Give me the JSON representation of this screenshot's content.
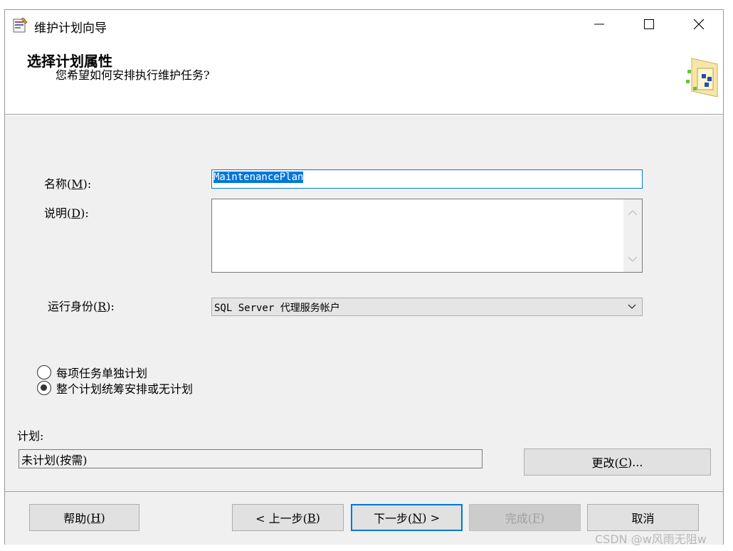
{
  "window": {
    "title": "维护计划向导"
  },
  "header": {
    "title": "选择计划属性",
    "subtitle": "您希望如何安排执行维护任务?"
  },
  "form": {
    "name_label_prefix": "名称(",
    "name_label_key": "M",
    "name_label_suffix": "):",
    "name_value": "MaintenancePlan",
    "desc_label_prefix": "说明(",
    "desc_label_key": "D",
    "desc_label_suffix": "):",
    "desc_value": "",
    "runas_label_prefix": "运行身份(",
    "runas_label_key": "R",
    "runas_label_suffix": "):",
    "runas_value": "SQL Server 代理服务帐户"
  },
  "schedule_options": {
    "option1": "每项任务单独计划",
    "option2": "整个计划统筹安排或无计划",
    "selected": "option2"
  },
  "schedule": {
    "label": "计划:",
    "value": "未计划(按需)",
    "change_prefix": "更改(",
    "change_key": "C",
    "change_suffix": ")..."
  },
  "footer": {
    "help_prefix": "帮助(",
    "help_key": "H",
    "help_suffix": ")",
    "back_prefix": "< 上一步(",
    "back_key": "B",
    "back_suffix": ")",
    "next_prefix": "下一步(",
    "next_key": "N",
    "next_suffix": ") >",
    "finish_prefix": "完成(",
    "finish_key": "F",
    "finish_suffix": ")",
    "cancel": "取消"
  },
  "watermark": "CSDN @w风雨无阻w",
  "colors": {
    "accent": "#0078d7",
    "dialog_bg": "#f0f0f0"
  }
}
